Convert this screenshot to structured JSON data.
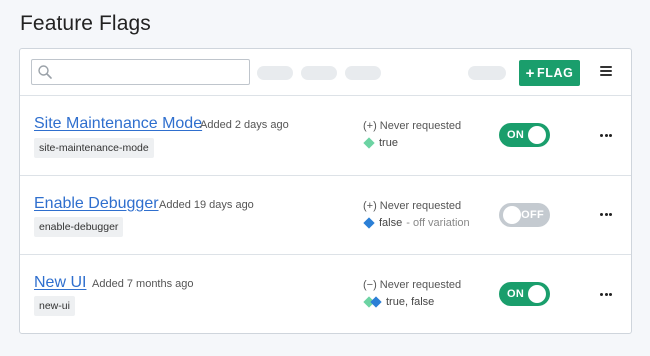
{
  "page": {
    "title": "Feature Flags"
  },
  "toolbar": {
    "search": {
      "placeholder": "",
      "value": ""
    },
    "add_flag_label": "FLAG",
    "add_flag_icon": "plus-icon",
    "menu_icon": "hamburger-menu-icon"
  },
  "flags": [
    {
      "name": "Site Maintenance Mode",
      "added": "Added 2 days ago",
      "key": "site-maintenance-mode",
      "requests": "(+) Never requested",
      "variation": "true",
      "variation_note": "",
      "variation_colors": [
        "#6cd3a3"
      ],
      "toggle_label": "ON",
      "is_on": true
    },
    {
      "name": "Enable Debugger",
      "added": "Added 19 days ago",
      "key": "enable-debugger",
      "requests": "(+) Never requested",
      "variation": "false",
      "variation_note": "- off variation",
      "variation_colors": [
        "#2b7fd6"
      ],
      "toggle_label": "OFF",
      "is_on": false
    },
    {
      "name": "New UI",
      "added": "Added 7 months ago",
      "key": "new-ui",
      "requests": "(−) Never requested",
      "variation": "true, false",
      "variation_note": "",
      "variation_colors": [
        "#6cd3a3",
        "#2b7fd6"
      ],
      "toggle_label": "ON",
      "is_on": true
    }
  ],
  "colors": {
    "accent": "#1a9e6c",
    "link": "#2f6fce",
    "toggle_off": "#c4cad0"
  }
}
